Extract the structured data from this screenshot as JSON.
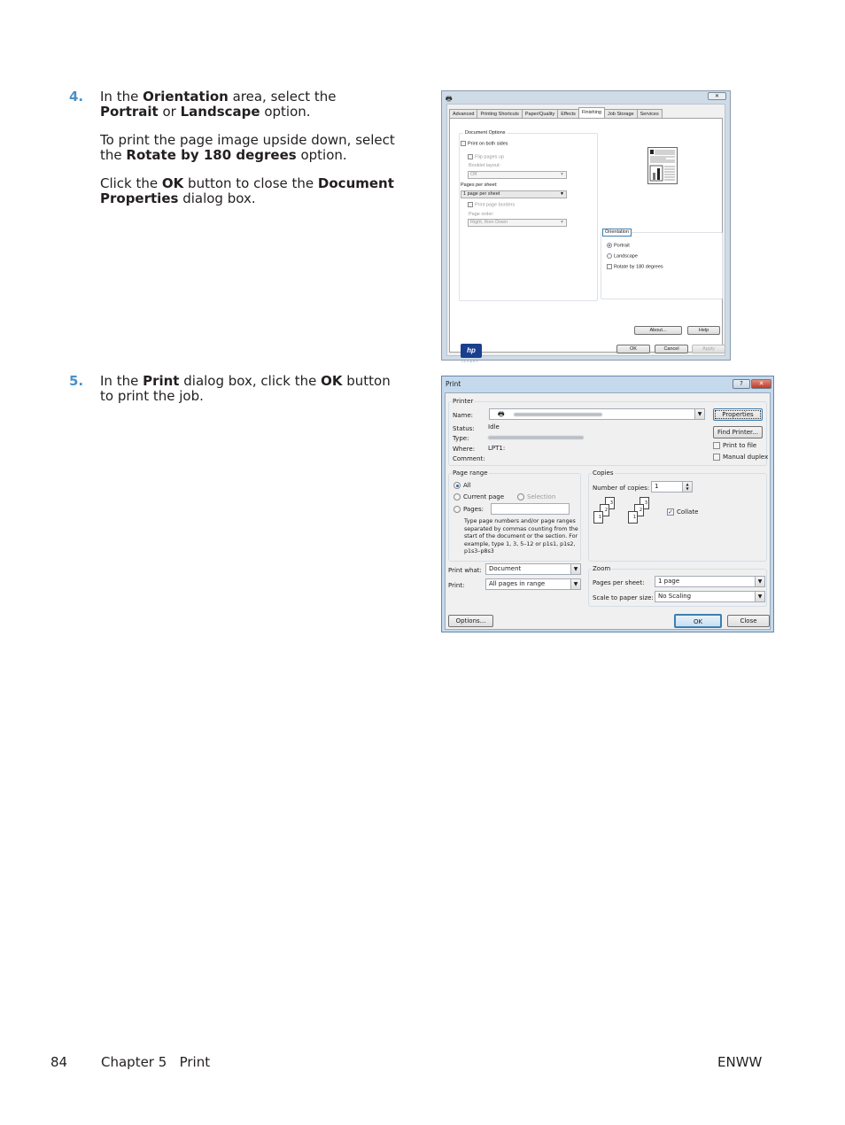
{
  "steps": [
    {
      "number": "4.",
      "paragraphs": [
        [
          {
            "t": "In the "
          },
          {
            "b": "Orientation"
          },
          {
            "t": " area, select the "
          },
          {
            "b": "Portrait"
          },
          {
            "t": " or "
          },
          {
            "b": "Landscape"
          },
          {
            "t": " option."
          }
        ],
        [
          {
            "t": "To print the page image upside down, select the "
          },
          {
            "b": "Rotate by 180 degrees"
          },
          {
            "t": " option."
          }
        ],
        [
          {
            "t": "Click the "
          },
          {
            "b": "OK"
          },
          {
            "t": " button to close the "
          },
          {
            "b": "Document Properties"
          },
          {
            "t": " dialog box."
          }
        ]
      ]
    },
    {
      "number": "5.",
      "paragraphs": [
        [
          {
            "t": "In the "
          },
          {
            "b": "Print"
          },
          {
            "t": " dialog box, click the "
          },
          {
            "b": "OK"
          },
          {
            "t": " button to print the job."
          }
        ]
      ]
    }
  ],
  "doc_props": {
    "close_glyph": "✕",
    "tabs": [
      "Advanced",
      "Printing Shortcuts",
      "Paper/Quality",
      "Effects",
      "Finishing",
      "Job Storage",
      "Services"
    ],
    "active_tab": "Finishing",
    "document_options_label": "Document Options",
    "print_both_sides": "Print on both sides",
    "flip_pages_up": "Flip pages up",
    "booklet_layout_label": "Booklet layout:",
    "booklet_layout_value": "Off",
    "pages_per_sheet_label": "Pages per sheet:",
    "pages_per_sheet_value": "1 page per sheet",
    "print_page_borders": "Print page borders",
    "page_order_label": "Page order:",
    "page_order_value": "Right, then Down",
    "orientation_label": "Orientation",
    "portrait": "Portrait",
    "landscape": "Landscape",
    "rotate_180": "Rotate by 180 degrees",
    "hp_logo": "hp",
    "hp_sub": "invent",
    "about_button": "About...",
    "help_button": "Help",
    "ok_button": "OK",
    "cancel_button": "Cancel",
    "apply_button": "Apply"
  },
  "print_dialog": {
    "title": "Print",
    "help_glyph": "?",
    "close_glyph": "✕",
    "printer_group": "Printer",
    "name_label": "Name:",
    "status_label": "Status:",
    "status_value": "Idle",
    "type_label": "Type:",
    "where_label": "Where:",
    "where_value": "LPT1:",
    "comment_label": "Comment:",
    "properties_button": "Properties",
    "find_printer_button": "Find Printer...",
    "print_to_file": "Print to file",
    "manual_duplex": "Manual duplex",
    "page_range_group": "Page range",
    "range_all": "All",
    "range_current": "Current page",
    "range_selection": "Selection",
    "range_pages": "Pages:",
    "range_help": "Type page numbers and/or page ranges separated by commas counting from the start of the document or the section. For example, type 1, 3, 5–12 or p1s1, p1s2, p1s3–p8s3",
    "copies_group": "Copies",
    "copies_label": "Number of copies:",
    "copies_value": "1",
    "collate": "Collate",
    "print_what_label": "Print what:",
    "print_what_value": "Document",
    "print_label": "Print:",
    "print_value": "All pages in range",
    "zoom_group": "Zoom",
    "pages_per_sheet_label": "Pages per sheet:",
    "pages_per_sheet_value": "1 page",
    "scale_label": "Scale to paper size:",
    "scale_value": "No Scaling",
    "options_button": "Options...",
    "ok_button": "OK",
    "close_button": "Close"
  },
  "footer": {
    "page_number": "84",
    "chapter": "Chapter 5   Print",
    "right": "ENWW"
  }
}
